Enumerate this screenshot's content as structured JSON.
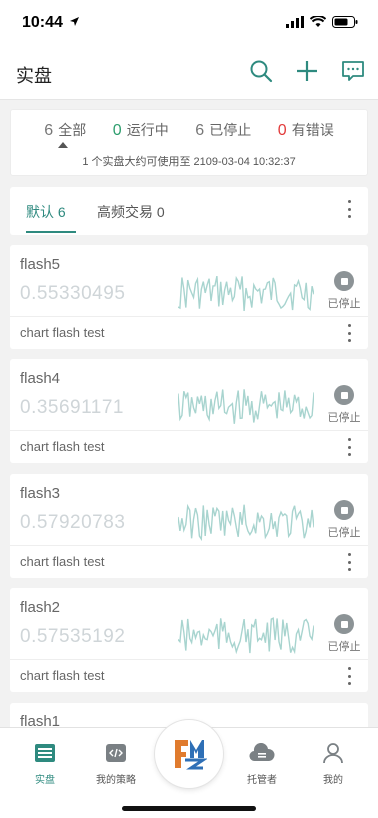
{
  "status_bar": {
    "time": "10:44"
  },
  "header": {
    "title": "实盘"
  },
  "summary": {
    "stats": [
      {
        "num": "6",
        "label": "全部",
        "color": "#777777"
      },
      {
        "num": "0",
        "label": "运行中",
        "color": "#2e9e6e"
      },
      {
        "num": "6",
        "label": "已停止",
        "color": "#777777"
      },
      {
        "num": "0",
        "label": "有错误",
        "color": "#e23b3b"
      }
    ],
    "note": "1 个实盘大约可使用至 2109-03-04 10:32:37"
  },
  "tabs": [
    {
      "label": "默认 6"
    },
    {
      "label": "高频交易 0"
    }
  ],
  "cards": [
    {
      "name": "flash5",
      "value": "0.55330495",
      "status": "已停止",
      "desc": "chart flash test"
    },
    {
      "name": "flash4",
      "value": "0.35691171",
      "status": "已停止",
      "desc": "chart flash test"
    },
    {
      "name": "flash3",
      "value": "0.57920783",
      "status": "已停止",
      "desc": "chart flash test"
    },
    {
      "name": "flash2",
      "value": "0.57535192",
      "status": "已停止",
      "desc": "chart flash test"
    }
  ],
  "partial_card": {
    "name": "flash1"
  },
  "tab_bar": [
    {
      "label": "实盘",
      "icon": "live-trading-icon"
    },
    {
      "label": "我的策略",
      "icon": "strategy-code-icon"
    },
    {
      "label": "托管者",
      "icon": "cloud-server-icon"
    },
    {
      "label": "我的",
      "icon": "user-icon"
    }
  ],
  "colors": {
    "accent": "#2e8a7f",
    "sparkline": "#a8d4cf",
    "error": "#e23b3b",
    "running": "#2e9e6e"
  }
}
